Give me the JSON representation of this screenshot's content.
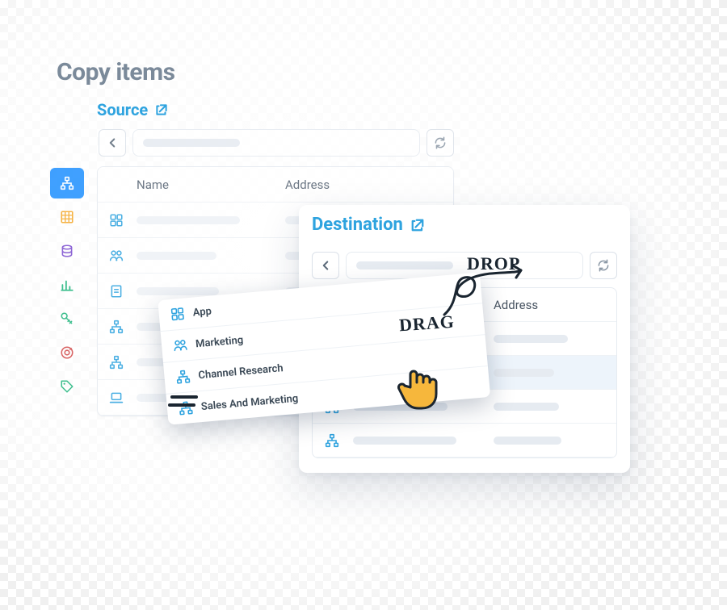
{
  "page": {
    "title": "Copy items"
  },
  "source": {
    "label": "Source"
  },
  "destination": {
    "label": "Destination"
  },
  "columns": {
    "name": "Name",
    "address": "Address"
  },
  "rail_items": [
    {
      "name": "hierarchy-icon",
      "active": true,
      "color": "#ffffff"
    },
    {
      "name": "table-icon",
      "active": false,
      "color": "#f5a623"
    },
    {
      "name": "database-icon",
      "active": false,
      "color": "#7a4bcf"
    },
    {
      "name": "chart-icon",
      "active": false,
      "color": "#1fb57c"
    },
    {
      "name": "key-icon",
      "active": false,
      "color": "#1fb57c"
    },
    {
      "name": "target-icon",
      "active": false,
      "color": "#d34a4a"
    },
    {
      "name": "tag-icon",
      "active": false,
      "color": "#1fb57c"
    }
  ],
  "source_rows": [
    {
      "icon": "app-icon"
    },
    {
      "icon": "people-icon"
    },
    {
      "icon": "note-icon"
    },
    {
      "icon": "hierarchy-icon"
    },
    {
      "icon": "hierarchy-icon"
    },
    {
      "icon": "laptop-icon"
    }
  ],
  "dest_rows": [
    {
      "icon": "hierarchy-icon"
    },
    {
      "icon": "hierarchy-icon"
    },
    {
      "icon": "hierarchy-icon"
    },
    {
      "icon": "hierarchy-icon"
    }
  ],
  "drag_items": [
    {
      "icon": "app-icon",
      "label": "App"
    },
    {
      "icon": "people-icon",
      "label": "Marketing"
    },
    {
      "icon": "hierarchy-icon",
      "label": "Channel Research"
    },
    {
      "icon": "hierarchy-icon",
      "label": "Sales And Marketing"
    }
  ],
  "annotations": {
    "drag": "DRAG",
    "drop": "DROP"
  },
  "colors": {
    "link": "#2ea3df",
    "title": "#7b8a9a",
    "annotation": "#1a2530"
  }
}
